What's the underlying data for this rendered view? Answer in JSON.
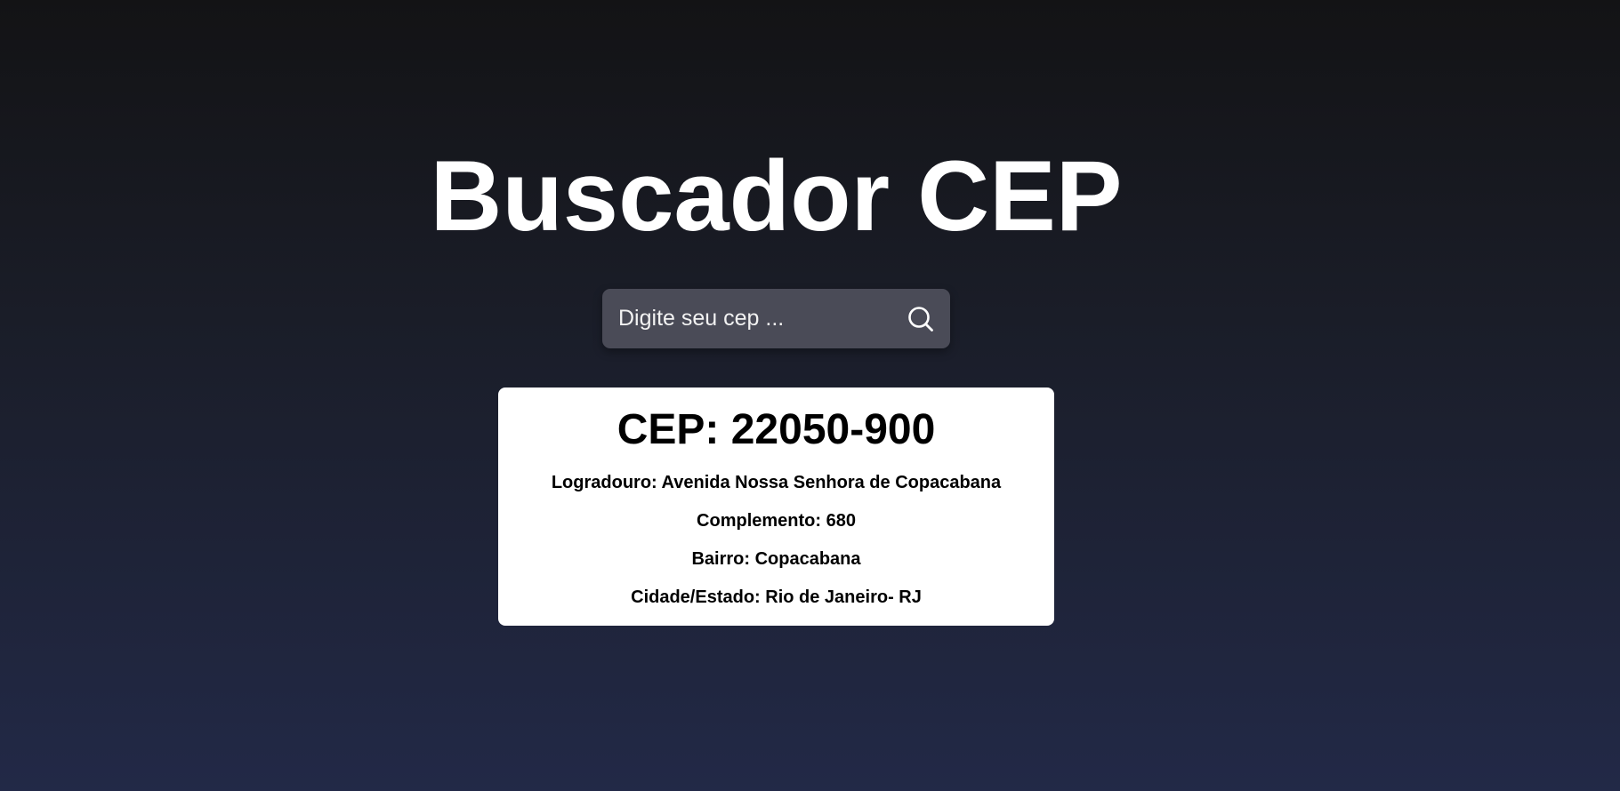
{
  "page": {
    "title": "Buscador CEP"
  },
  "search": {
    "placeholder": "Digite seu cep ...",
    "value": "",
    "button_icon": "search-icon"
  },
  "result": {
    "cep_line": "CEP: 22050-900",
    "logradouro_line": "Logradouro: Avenida Nossa Senhora de Copacabana",
    "complemento_line": "Complemento: 680",
    "bairro_line": "Bairro: Copacabana",
    "cidade_estado_line": "Cidade/Estado: Rio de Janeiro- RJ"
  },
  "colors": {
    "background_top": "#131315",
    "background_bottom": "#222947",
    "search_box": "#4a4b57",
    "card": "#ffffff",
    "title_text": "#ffffff",
    "card_text": "#000000"
  }
}
